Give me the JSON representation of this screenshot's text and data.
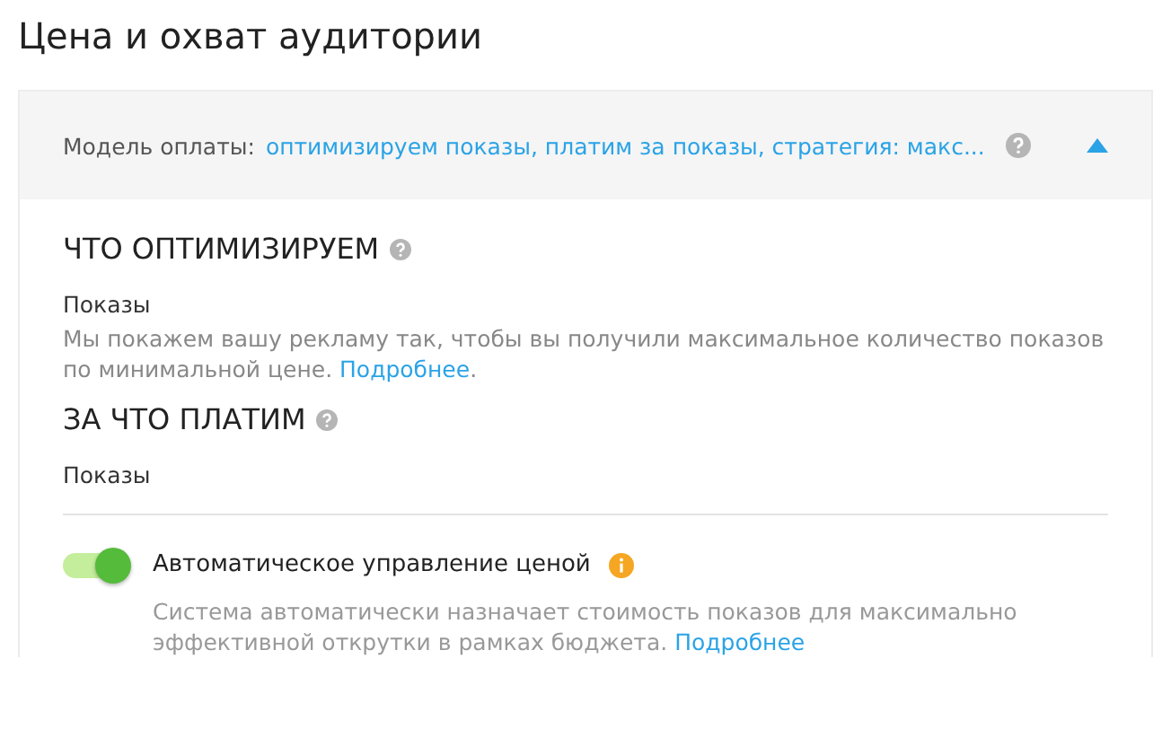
{
  "title": "Цена и охват аудитории",
  "panel": {
    "label": "Модель оплаты:",
    "value": "оптимизируем показы, платим за показы, стратегия: макс...",
    "expanded": true,
    "sections": [
      {
        "heading": "ЧТО ОПТИМИЗИРУЕМ",
        "value": "Показы",
        "text": "Мы покажем вашу рекламу так, чтобы вы получили максимальное количество показов по минимальной цене.",
        "link": "Подробнее",
        "after": "."
      },
      {
        "heading": "ЗА ЧТО ПЛАТИМ",
        "value": "Показы"
      }
    ],
    "toggle": {
      "label": "Автоматическое управление ценой",
      "on": true,
      "text": "Система автоматически назначает стоимость показов для максимально эффективной открутки в рамках бюджета.",
      "link": "Подробнее"
    }
  }
}
